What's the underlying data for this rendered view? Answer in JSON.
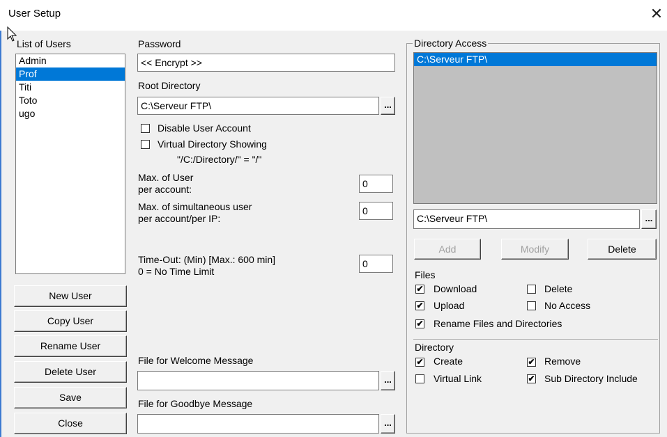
{
  "window": {
    "title": "User Setup"
  },
  "users": {
    "label": "List of Users",
    "items": [
      {
        "label": "Admin",
        "selected": false
      },
      {
        "label": "Prof",
        "selected": true
      },
      {
        "label": "Titi",
        "selected": false
      },
      {
        "label": "Toto",
        "selected": false
      },
      {
        "label": "ugo",
        "selected": false
      }
    ],
    "buttons": [
      "New User",
      "Copy User",
      "Rename User",
      "Delete User",
      "Save",
      "Close"
    ]
  },
  "password": {
    "label": "Password",
    "value": "<< Encrypt >>"
  },
  "root": {
    "label": "Root Directory",
    "value": "C:\\Serveur FTP\\",
    "browse": "..."
  },
  "disable_account": {
    "label": "Disable User Account",
    "checked": false
  },
  "virtual_dir": {
    "label": "Virtual Directory Showing",
    "hint": "\"/C:/Directory/\" = \"/\"",
    "checked": false
  },
  "max_user": {
    "label": "Max. of User\nper account:",
    "value": "0"
  },
  "max_ip": {
    "label": "Max. of simultaneous user\nper account/per IP:",
    "value": "0"
  },
  "timeout": {
    "label": "Time-Out: (Min) [Max.: 600 min]\n0 = No Time Limit",
    "value": "0"
  },
  "welcome": {
    "label": "File for Welcome Message",
    "value": ""
  },
  "goodbye": {
    "label": "File for Goodbye Message",
    "value": ""
  },
  "directory_access": {
    "label": "Directory Access",
    "items": [
      {
        "label": "C:\\Serveur FTP\\",
        "selected": true
      }
    ],
    "path_value": "C:\\Serveur FTP\\",
    "buttons": {
      "add": "Add",
      "modify": "Modify",
      "delete": "Delete"
    }
  },
  "files": {
    "label": "Files",
    "download": {
      "label": "Download",
      "checked": true
    },
    "delete": {
      "label": "Delete",
      "checked": false
    },
    "upload": {
      "label": "Upload",
      "checked": true
    },
    "no_access": {
      "label": "No Access",
      "checked": false
    },
    "rename": {
      "label": "Rename Files and Directories",
      "checked": true
    }
  },
  "directory": {
    "label": "Directory",
    "create": {
      "label": "Create",
      "checked": true
    },
    "remove": {
      "label": "Remove",
      "checked": true
    },
    "virtual_link": {
      "label": "Virtual Link",
      "checked": false
    },
    "sub_include": {
      "label": "Sub Directory Include",
      "checked": true
    }
  },
  "check_mark": "✔"
}
